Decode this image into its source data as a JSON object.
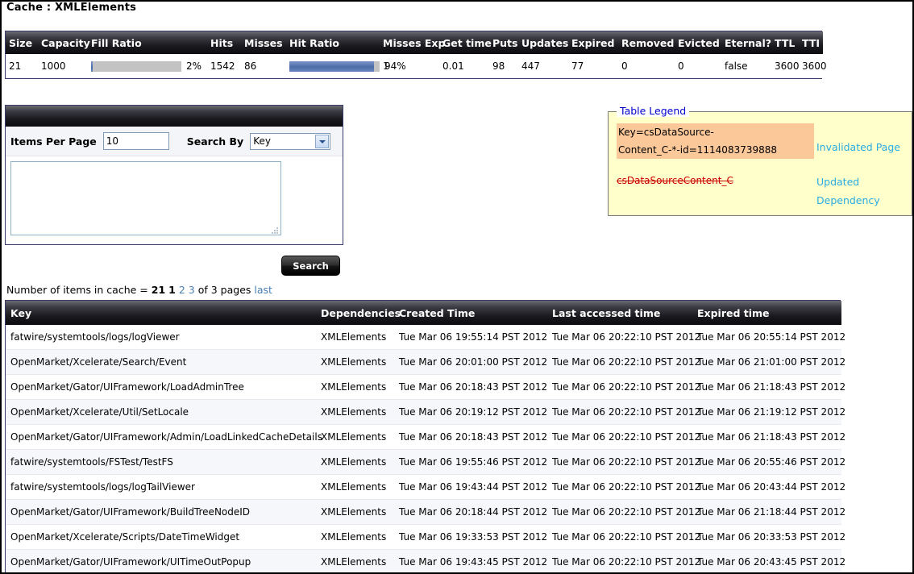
{
  "page": {
    "title": "Cache : XMLElements"
  },
  "stats": {
    "columns": [
      "Size",
      "Capacity",
      "Fill Ratio",
      "Hits",
      "Misses",
      "Hit Ratio",
      "Misses Exp",
      "Get time",
      "Puts",
      "Updates",
      "Expired",
      "Removed",
      "Evicted",
      "Eternal?",
      "TTL",
      "TTI"
    ],
    "row": {
      "size": "21",
      "capacity": "1000",
      "fill_ratio_pct": "2%",
      "fill_ratio_value": 2,
      "hits": "1542",
      "misses": "86",
      "hit_ratio_pct": "94%",
      "hit_ratio_value": 94,
      "misses_exp": "1",
      "get_time": "0.01",
      "puts": "98",
      "updates": "447",
      "expired": "77",
      "removed": "0",
      "evicted": "0",
      "eternal": "false",
      "ttl": "3600",
      "tti": "3600"
    }
  },
  "search": {
    "items_per_page_label": "Items Per Page",
    "items_per_page_value": "10",
    "search_by_label": "Search By",
    "search_by_selected": "Key",
    "search_by_options": [
      "Key"
    ],
    "query_value": "",
    "query_placeholder": "",
    "search_button": "Search"
  },
  "legend": {
    "title": "Table Legend",
    "key_sample_line1": "Key=csDataSource-",
    "key_sample_line2": "Content_C-*-id=1114083739888",
    "strike_sample": "csDataSourceContent_C",
    "label_invalidated": "Invalidated Page",
    "label_updated": "Updated",
    "label_dependency": "Dependency",
    "colors": {
      "highlight_bg": "#fbc89a",
      "panel_bg": "#ffffcc",
      "strike_text": "#cc0000",
      "label_text": "#2aabe2",
      "title_text": "#0000cc"
    }
  },
  "pager": {
    "prefix": "Number of items in cache =",
    "count": "21",
    "current_page": "1",
    "other_pages": [
      "2",
      "3"
    ],
    "of_text": "of 3 pages",
    "last_label": "last"
  },
  "results": {
    "columns": [
      "Key",
      "Dependencies",
      "Created Time",
      "Last accessed time",
      "Expired time"
    ],
    "rows": [
      {
        "key": "fatwire/systemtools/logs/logViewer",
        "dependencies": "XMLElements",
        "created": "Tue Mar 06 19:55:14 PST 2012",
        "accessed": "Tue Mar 06 20:22:10 PST 2012",
        "expired": "Tue Mar 06 20:55:14 PST 2012"
      },
      {
        "key": "OpenMarket/Xcelerate/Search/Event",
        "dependencies": "XMLElements",
        "created": "Tue Mar 06 20:01:00 PST 2012",
        "accessed": "Tue Mar 06 20:22:10 PST 2012",
        "expired": "Tue Mar 06 21:01:00 PST 2012"
      },
      {
        "key": "OpenMarket/Gator/UIFramework/LoadAdminTree",
        "dependencies": "XMLElements",
        "created": "Tue Mar 06 20:18:43 PST 2012",
        "accessed": "Tue Mar 06 20:22:10 PST 2012",
        "expired": "Tue Mar 06 21:18:43 PST 2012"
      },
      {
        "key": "OpenMarket/Xcelerate/Util/SetLocale",
        "dependencies": "XMLElements",
        "created": "Tue Mar 06 20:19:12 PST 2012",
        "accessed": "Tue Mar 06 20:22:10 PST 2012",
        "expired": "Tue Mar 06 21:19:12 PST 2012"
      },
      {
        "key": "OpenMarket/Gator/UIFramework/Admin/LoadLinkedCacheDetails",
        "dependencies": "XMLElements",
        "created": "Tue Mar 06 20:18:43 PST 2012",
        "accessed": "Tue Mar 06 20:22:10 PST 2012",
        "expired": "Tue Mar 06 21:18:43 PST 2012"
      },
      {
        "key": "fatwire/systemtools/FSTest/TestFS",
        "dependencies": "XMLElements",
        "created": "Tue Mar 06 19:55:46 PST 2012",
        "accessed": "Tue Mar 06 20:22:10 PST 2012",
        "expired": "Tue Mar 06 20:55:46 PST 2012"
      },
      {
        "key": "fatwire/systemtools/logs/logTailViewer",
        "dependencies": "XMLElements",
        "created": "Tue Mar 06 19:43:44 PST 2012",
        "accessed": "Tue Mar 06 20:22:10 PST 2012",
        "expired": "Tue Mar 06 20:43:44 PST 2012"
      },
      {
        "key": "OpenMarket/Gator/UIFramework/BuildTreeNodeID",
        "dependencies": "XMLElements",
        "created": "Tue Mar 06 20:18:44 PST 2012",
        "accessed": "Tue Mar 06 20:22:10 PST 2012",
        "expired": "Tue Mar 06 21:18:44 PST 2012"
      },
      {
        "key": "OpenMarket/Xcelerate/Scripts/DateTimeWidget",
        "dependencies": "XMLElements",
        "created": "Tue Mar 06 19:33:53 PST 2012",
        "accessed": "Tue Mar 06 20:22:10 PST 2012",
        "expired": "Tue Mar 06 20:33:53 PST 2012"
      },
      {
        "key": "OpenMarket/Gator/UIFramework/UITimeOutPopup",
        "dependencies": "XMLElements",
        "created": "Tue Mar 06 19:43:45 PST 2012",
        "accessed": "Tue Mar 06 20:22:10 PST 2012",
        "expired": "Tue Mar 06 20:43:45 PST 2012"
      }
    ]
  }
}
